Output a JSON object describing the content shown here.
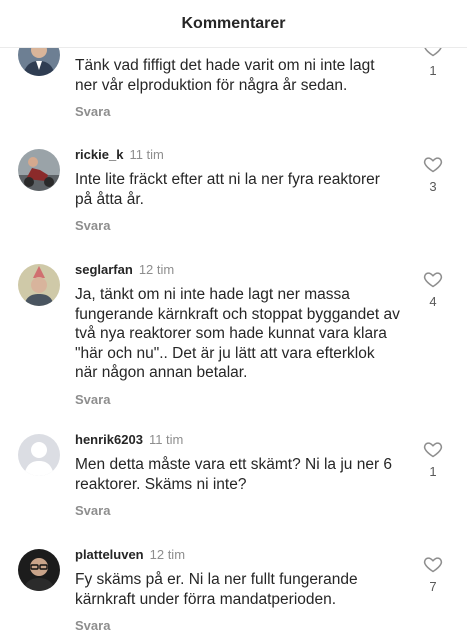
{
  "header": {
    "title": "Kommentarer"
  },
  "comments": [
    {
      "username": "",
      "time": "",
      "text": "Tänk vad fiffigt det hade varit om ni inte lagt ner vår elproduktion för några år sedan.",
      "reply_label": "Svara",
      "likes": "1",
      "avatar": {
        "type": "photo-man-suit",
        "colors": [
          "#4a5b72",
          "#d9b59a"
        ]
      }
    },
    {
      "username": "rickie_k",
      "time": "11 tim",
      "text": "Inte lite fräckt efter att ni la ner fyra reaktorer på åtta år.",
      "reply_label": "Svara",
      "likes": "3",
      "avatar": {
        "type": "photo-motorcycle",
        "colors": [
          "#8b2a2a",
          "#6e6e6e"
        ]
      }
    },
    {
      "username": "seglarfan",
      "time": "12 tim",
      "text": "Ja, tänkt om ni inte hade lagt ner massa fungerande kärnkraft och stoppat byggandet av två nya reaktorer som hade kunnat vara klara \"här och nu\".. Det är ju lätt att vara efterklok när någon annan betalar.",
      "reply_label": "Svara",
      "likes": "4",
      "avatar": {
        "type": "photo-party-hat",
        "colors": [
          "#c8c2a0",
          "#d07070"
        ]
      }
    },
    {
      "username": "henrik6203",
      "time": "11 tim",
      "text": "Men detta måste vara ett skämt? Ni la ju ner 6 reaktorer. Skäms ni inte?",
      "reply_label": "Svara",
      "likes": "1",
      "avatar": {
        "type": "default-silhouette",
        "colors": [
          "#dbdde3",
          "#ffffff"
        ]
      }
    },
    {
      "username": "platteluven",
      "time": "12 tim",
      "text": "Fy skäms på er. Ni la ner fullt fungerande kärnkraft under förra mandatperioden.",
      "reply_label": "Svara",
      "likes": "7",
      "avatar": {
        "type": "photo-man-glasses-dark",
        "colors": [
          "#1a1a1a",
          "#c9a48a"
        ]
      }
    }
  ],
  "icons": {
    "like": "heart-outline-icon"
  },
  "colors": {
    "text": "#262626",
    "secondary": "#8e8e8e",
    "divider": "#ebebeb"
  }
}
